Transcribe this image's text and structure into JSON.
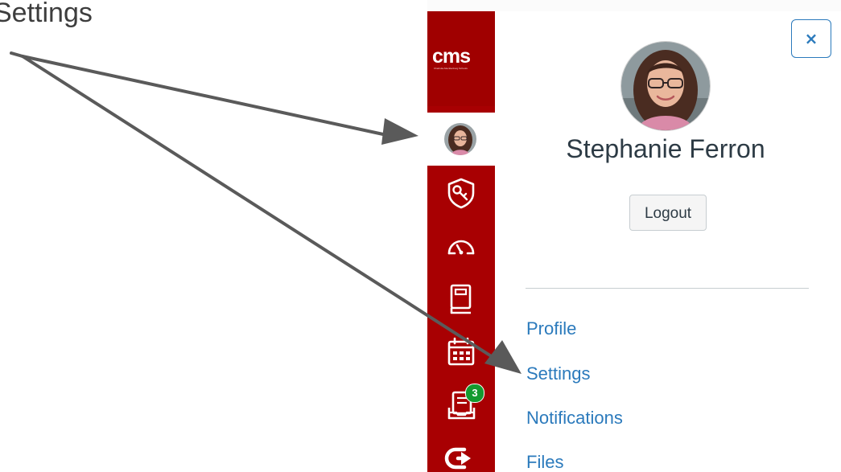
{
  "annotation": {
    "label": "Settings"
  },
  "global_nav": {
    "logo_text": "cms",
    "logo_subtext": "Charlotte-Mecklenburg Schools",
    "items": [
      {
        "icon": "user-avatar-icon",
        "label": "Account"
      },
      {
        "icon": "shield-key-icon",
        "label": "Admin"
      },
      {
        "icon": "speedometer-icon",
        "label": "Dashboard"
      },
      {
        "icon": "book-icon",
        "label": "Courses"
      },
      {
        "icon": "calendar-icon",
        "label": "Calendar"
      },
      {
        "icon": "inbox-icon",
        "label": "Inbox",
        "badge": "3"
      },
      {
        "icon": "arrow-exit-icon",
        "label": "Commons"
      }
    ]
  },
  "tray": {
    "close_icon": "×",
    "user_name": "Stephanie Ferron",
    "logout_label": "Logout",
    "links": [
      {
        "label": "Profile"
      },
      {
        "label": "Settings"
      },
      {
        "label": "Notifications"
      },
      {
        "label": "Files"
      }
    ]
  },
  "colors": {
    "nav_background": "#a80002",
    "link": "#2b7abc",
    "badge": "#149a2f",
    "arrow": "#5a5a5a"
  }
}
